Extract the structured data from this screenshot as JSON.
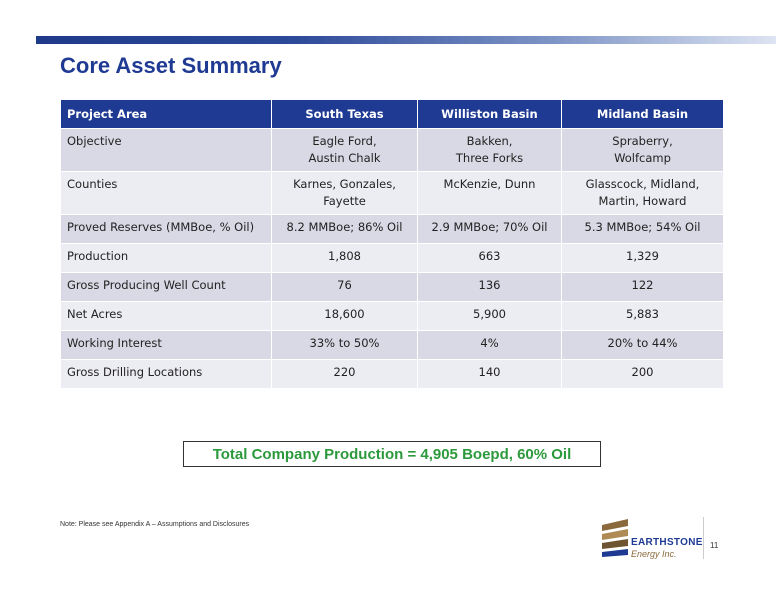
{
  "slide": {
    "title": "Core Asset Summary",
    "page_number": "11",
    "note": "Note:   Please see Appendix A – Assumptions and Disclosures",
    "total": "Total Company Production = 4,905 Boepd, 60% Oil"
  },
  "table": {
    "headers": [
      "Project Area",
      "South Texas",
      "Williston Basin",
      "Midland Basin"
    ],
    "rows": [
      {
        "label": "Objective",
        "cells": [
          [
            "Eagle Ford,",
            "Austin Chalk"
          ],
          [
            "Bakken,",
            "Three Forks"
          ],
          [
            "Spraberry,",
            "Wolfcamp"
          ]
        ]
      },
      {
        "label": "Counties",
        "cells": [
          [
            "Karnes, Gonzales,",
            "Fayette"
          ],
          [
            "McKenzie, Dunn"
          ],
          [
            "Glasscock, Midland,",
            "Martin, Howard"
          ]
        ]
      },
      {
        "label": "Proved Reserves (MMBoe, % Oil)",
        "cells": [
          [
            "8.2 MMBoe; 86% Oil"
          ],
          [
            "2.9 MMBoe; 70% Oil"
          ],
          [
            "5.3 MMBoe; 54% Oil"
          ]
        ]
      },
      {
        "label": "Production",
        "cells": [
          [
            "1,808"
          ],
          [
            "663"
          ],
          [
            "1,329"
          ]
        ]
      },
      {
        "label": "Gross Producing Well Count",
        "cells": [
          [
            "76"
          ],
          [
            "136"
          ],
          [
            "122"
          ]
        ]
      },
      {
        "label": "Net Acres",
        "cells": [
          [
            "18,600"
          ],
          [
            "5,900"
          ],
          [
            "5,883"
          ]
        ]
      },
      {
        "label": "Working Interest",
        "cells": [
          [
            "33% to 50%"
          ],
          [
            "4%"
          ],
          [
            "20% to 44%"
          ]
        ]
      },
      {
        "label": "Gross Drilling Locations",
        "cells": [
          [
            "220"
          ],
          [
            "140"
          ],
          [
            "200"
          ]
        ]
      }
    ]
  },
  "logo": {
    "name": "EARTHSTONE",
    "sub": "Energy Inc."
  },
  "colors": {
    "accent": "#1f3a93",
    "total_text": "#2c9a3c",
    "row_odd": "#d9d9e6",
    "row_even": "#ececf3"
  }
}
